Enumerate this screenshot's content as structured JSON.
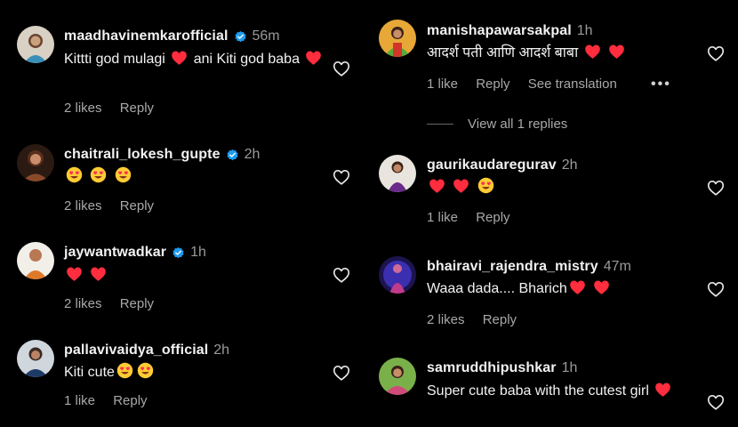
{
  "colors": {
    "background": "#000000",
    "text": "#f2f2f2",
    "muted": "#a8a8a8",
    "verified": "#1d9bf0",
    "heart": "#ff2d3d"
  },
  "left": [
    {
      "username": "maadhavinemkarofficial",
      "verified": true,
      "time": "56m",
      "text_parts": [
        "Kittti god mulagi",
        "ani Kiti god",
        "baba"
      ],
      "likes": "2 likes",
      "reply": "Reply"
    },
    {
      "username": "chaitrali_lokesh_gupte",
      "verified": true,
      "time": "2h",
      "likes": "2 likes",
      "reply": "Reply"
    },
    {
      "username": "jaywantwadkar",
      "verified": true,
      "time": "1h",
      "likes": "2 likes",
      "reply": "Reply"
    },
    {
      "username": "pallavivaidya_official",
      "verified": false,
      "time": "2h",
      "text": "Kiti cute",
      "likes": "1 like",
      "reply": "Reply"
    }
  ],
  "right": [
    {
      "username": "manishapawarsakpal",
      "verified": false,
      "time": "1h",
      "text": "आदर्श पती आणि आदर्श बाबा",
      "likes": "1 like",
      "reply": "Reply",
      "translate": "See translation",
      "more": "•••",
      "view_replies": "View all 1 replies"
    },
    {
      "username": "gaurikaudaregurav",
      "verified": false,
      "time": "2h",
      "likes": "1 like",
      "reply": "Reply"
    },
    {
      "username": "bhairavi_rajendra_mistry",
      "verified": false,
      "time": "47m",
      "text": "Waaa dada.... Bharich",
      "likes": "2 likes",
      "reply": "Reply"
    },
    {
      "username": "samruddhipushkar",
      "verified": false,
      "time": "1h",
      "text": "Super cute baba with the cutest girl"
    }
  ],
  "icons": {
    "like": "heart-outline-icon",
    "verified": "verified-badge-icon",
    "red_heart": "red-heart-emoji",
    "heart_eyes": "heart-eyes-emoji"
  }
}
